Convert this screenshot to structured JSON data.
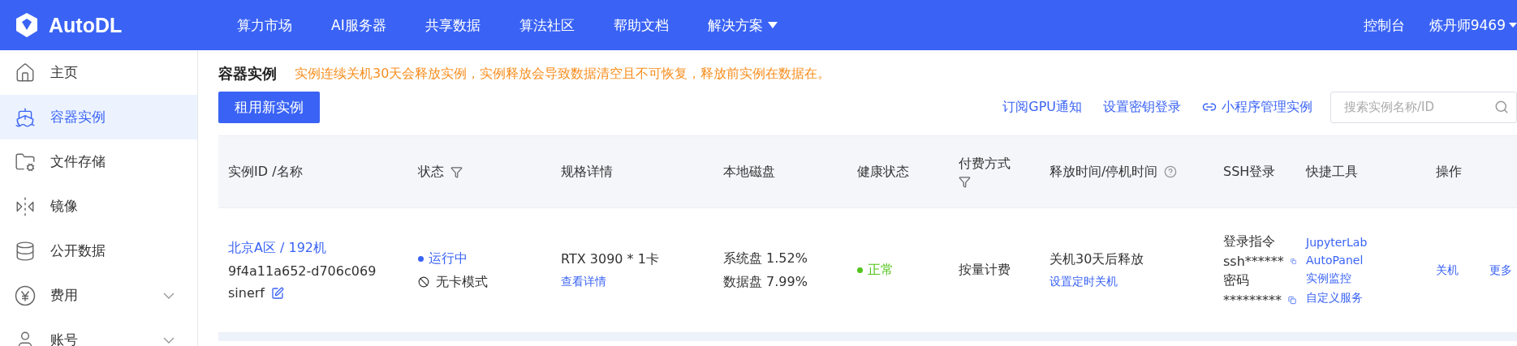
{
  "header": {
    "brand": "AutoDL",
    "nav": [
      {
        "label": "算力市场",
        "dropdown": false
      },
      {
        "label": "AI服务器",
        "dropdown": false
      },
      {
        "label": "共享数据",
        "dropdown": false
      },
      {
        "label": "算法社区",
        "dropdown": false
      },
      {
        "label": "帮助文档",
        "dropdown": false
      },
      {
        "label": "解决方案",
        "dropdown": true
      }
    ],
    "console": "控制台",
    "user": "炼丹师9469"
  },
  "sidebar": {
    "items": [
      {
        "label": "主页",
        "selected": false,
        "kind": "link"
      },
      {
        "label": "容器实例",
        "selected": true,
        "kind": "link"
      },
      {
        "label": "文件存储",
        "selected": false,
        "kind": "link"
      },
      {
        "label": "镜像",
        "selected": false,
        "kind": "link"
      },
      {
        "label": "公开数据",
        "selected": false,
        "kind": "link"
      },
      {
        "label": "费用",
        "selected": false,
        "kind": "group"
      },
      {
        "label": "账号",
        "selected": false,
        "kind": "group"
      }
    ]
  },
  "page": {
    "title": "容器实例",
    "notice": "实例连续关机30天会释放实例，实例释放会导致数据清空且不可恢复，释放前实例在数据在。",
    "new_button": "租用新实例",
    "links": [
      "订阅GPU通知",
      "设置密钥登录"
    ],
    "mini_program": "小程序管理实例",
    "search": {
      "placeholder": "搜索实例名称/ID"
    }
  },
  "table": {
    "columns": [
      {
        "label": "实例ID /名称",
        "filter": false,
        "help": false
      },
      {
        "label": "状态",
        "filter": true,
        "help": false
      },
      {
        "label": "规格详情",
        "filter": false,
        "help": false
      },
      {
        "label": "本地磁盘",
        "filter": false,
        "help": false
      },
      {
        "label": "健康状态",
        "filter": false,
        "help": false
      },
      {
        "label": "付费方式",
        "filter": true,
        "help": false
      },
      {
        "label": "释放时间/停机时间",
        "filter": false,
        "help": true
      },
      {
        "label": "SSH登录",
        "filter": false,
        "help": false
      },
      {
        "label": "快捷工具",
        "filter": false,
        "help": false
      },
      {
        "label": "操作",
        "filter": false,
        "help": false
      }
    ],
    "rows": [
      {
        "region": "北京A区 / 192机",
        "id": "9f4a11a652-d706c069",
        "name": "sinerf",
        "status": "运行中",
        "mode": "无卡模式",
        "gpu": "RTX 3090 * 1卡",
        "spec_link": "查看详情",
        "system_disk": "系统盘 1.52%",
        "data_disk": "数据盘 7.99%",
        "health": "正常",
        "billing": "按量计费",
        "release": "关机30天后释放",
        "release_link": "设置定时关机",
        "ssh_label": "登录指令",
        "ssh_command": "ssh******",
        "password_label": "密码",
        "password": "*********",
        "tools": [
          "JupyterLab",
          "AutoPanel",
          "实例监控",
          "自定义服务"
        ],
        "actions": [
          "关机",
          "更多"
        ]
      }
    ]
  }
}
